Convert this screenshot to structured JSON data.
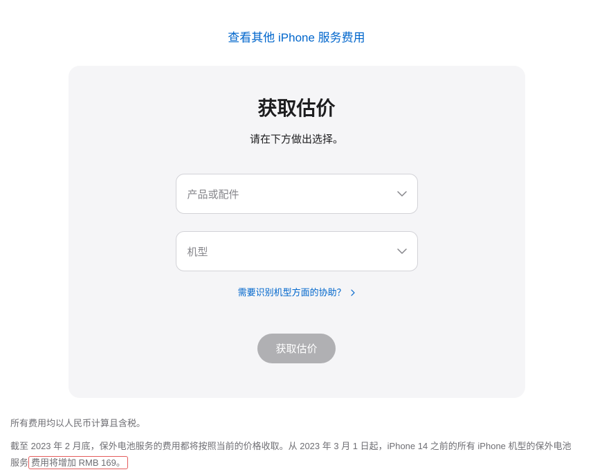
{
  "topLink": {
    "text": "查看其他 iPhone 服务费用"
  },
  "card": {
    "title": "获取估价",
    "subtitle": "请在下方做出选择。",
    "select_product": "产品或配件",
    "select_model": "机型",
    "help_link": "需要识别机型方面的协助？",
    "submit": "获取估价"
  },
  "disclaimer": {
    "line1": "所有费用均以人民币计算且含税。",
    "line2_part1": "截至 2023 年 2 月底，保外电池服务的费用都将按照当前的价格收取。从 2023 年 3 月 1 日起，iPhone 14 之前的所有 iPhone 机型的保外电池服务",
    "line2_part2": "费用将增加 RMB 169。"
  }
}
